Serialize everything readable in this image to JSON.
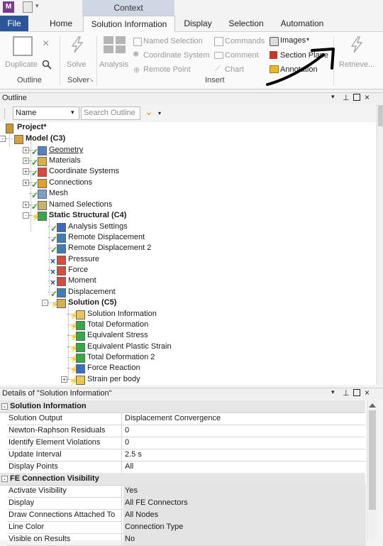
{
  "app": {
    "icon_letter": "M"
  },
  "context_label": "Context",
  "tabs": [
    "File",
    "Home",
    "Solution Information",
    "Display",
    "Selection",
    "Automation"
  ],
  "ribbon": {
    "duplicate": "Duplicate",
    "outline_group": "Outline",
    "solve": "Solve",
    "solver_group": "Solver",
    "analysis": "Analysis",
    "named_selection": "Named Selection",
    "coordinate_system": "Coordinate System",
    "remote_point": "Remote Point",
    "commands": "Commands",
    "comment": "Comment",
    "chart": "Chart",
    "images": "Images",
    "section_plane": "Section Plane",
    "annotation": "Annotation",
    "insert_group": "Insert",
    "retrieve": "Retrieve..."
  },
  "outline": {
    "title": "Outline",
    "name_select": "Name",
    "search_placeholder": "Search Outline",
    "tree": [
      {
        "label": "Project*",
        "bold": true
      },
      {
        "label": "Model (C3)",
        "bold": true
      },
      {
        "label": "Geometry",
        "underline": true
      },
      {
        "label": "Materials"
      },
      {
        "label": "Coordinate Systems"
      },
      {
        "label": "Connections"
      },
      {
        "label": "Mesh"
      },
      {
        "label": "Named Selections"
      },
      {
        "label": "Static Structural (C4)",
        "bold": true
      },
      {
        "label": "Analysis Settings"
      },
      {
        "label": "Remote Displacement"
      },
      {
        "label": "Remote Displacement 2"
      },
      {
        "label": "Pressure"
      },
      {
        "label": "Force"
      },
      {
        "label": "Moment"
      },
      {
        "label": "Displacement"
      },
      {
        "label": "Solution (C5)",
        "bold": true
      },
      {
        "label": "Solution Information"
      },
      {
        "label": "Total Deformation"
      },
      {
        "label": "Equivalent Stress"
      },
      {
        "label": "Equivalent Plastic Strain"
      },
      {
        "label": "Total Deformation 2"
      },
      {
        "label": "Force Reaction"
      },
      {
        "label": "Strain per body"
      }
    ]
  },
  "details": {
    "title": "Details of \"Solution Information\"",
    "sections": [
      {
        "title": "Solution Information",
        "rows": [
          {
            "key": "Solution Output",
            "value": "Displacement Convergence"
          },
          {
            "key": "Newton-Raphson Residuals",
            "value": "0"
          },
          {
            "key": "Identify Element Violations",
            "value": "0"
          },
          {
            "key": "Update Interval",
            "value": "2.5 s"
          },
          {
            "key": "Display Points",
            "value": "All"
          }
        ]
      },
      {
        "title": "FE Connection Visibility",
        "rows": [
          {
            "key": "Activate Visibility",
            "value": "Yes"
          },
          {
            "key": "Display",
            "value": "All FE Connectors"
          },
          {
            "key": "Draw Connections Attached To",
            "value": "All Nodes"
          },
          {
            "key": "Line Color",
            "value": "Connection Type"
          },
          {
            "key": "Visible on Results",
            "value": "No"
          }
        ]
      }
    ]
  },
  "colors": {
    "file_tab": "#2b579a",
    "context": "#cfd6e4",
    "check": "#2e9a2e",
    "bolt": "#2e9a2e",
    "x_mark": "#1f3f9a"
  }
}
